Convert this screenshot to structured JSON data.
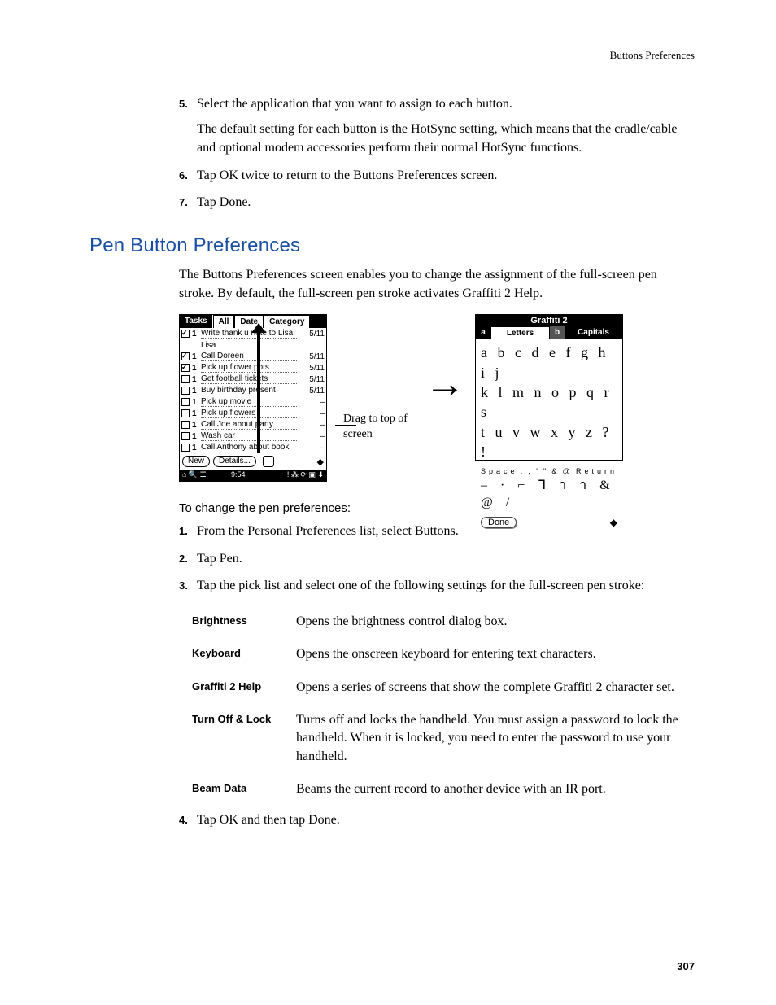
{
  "runningHead": "Buttons Preferences",
  "stepsTop": [
    {
      "n": "5.",
      "text": "Select the application that you want to assign to each button.",
      "sub": "The default setting for each button is the HotSync setting, which means that the cradle/cable and optional modem accessories perform their normal HotSync functions."
    },
    {
      "n": "6.",
      "text": "Tap OK twice to return to the Buttons Preferences screen."
    },
    {
      "n": "7.",
      "text": "Tap Done."
    }
  ],
  "sectionTitle": "Pen Button Preferences",
  "sectionIntro": "The Buttons Preferences screen enables you to change the assignment of the full-screen pen stroke. By default, the full-screen pen stroke activates Graffiti 2 Help.",
  "fig": {
    "tasks": {
      "tabs": [
        "Tasks",
        "All",
        "Date",
        "Category"
      ],
      "rows": [
        {
          "checked": true,
          "pri": "1",
          "text": "Write thank u note to Lisa",
          "date": "5/11",
          "wrap": true
        },
        {
          "checked": true,
          "pri": "1",
          "text": "Call Doreen",
          "date": "5/11"
        },
        {
          "checked": true,
          "pri": "1",
          "text": "Pick up flower pots",
          "date": "5/11"
        },
        {
          "checked": false,
          "pri": "1",
          "text": "Get football tickets",
          "date": "5/11"
        },
        {
          "checked": false,
          "pri": "1",
          "text": "Buy birthday present",
          "date": "5/11"
        },
        {
          "checked": false,
          "pri": "1",
          "text": "Pick up movie",
          "date": "–"
        },
        {
          "checked": false,
          "pri": "1",
          "text": "Pick up flowers",
          "date": "–"
        },
        {
          "checked": false,
          "pri": "1",
          "text": "Call Joe about party",
          "date": "–"
        },
        {
          "checked": false,
          "pri": "1",
          "text": "Wash car",
          "date": "–"
        },
        {
          "checked": false,
          "pri": "1",
          "text": "Call Anthony about book",
          "date": "–"
        }
      ],
      "btnNew": "New",
      "btnDetails": "Details...",
      "time": "9:54"
    },
    "callout": "Drag to top of screen",
    "graffiti": {
      "title": "Graffiti 2",
      "tabLetters": "Letters",
      "tabCapitals": "Capitals",
      "line1": "a b c d e f g h i j",
      "line2": "k l m n o p q r s",
      "line3": "t u v w x y z ? !",
      "labels": [
        "Space",
        ".",
        ",",
        "'",
        "\"",
        "&",
        "@",
        "Return"
      ],
      "syms": "–  · ⌐ ᒣ า า & @  /",
      "done": "Done"
    }
  },
  "subHeading": "To change the pen preferences:",
  "stepsBottom": [
    {
      "n": "1.",
      "text": "From the Personal Preferences list, select Buttons."
    },
    {
      "n": "2.",
      "text": "Tap Pen."
    },
    {
      "n": "3.",
      "text": "Tap the pick list and select one of the following settings for the full-screen pen stroke:"
    }
  ],
  "options": [
    {
      "label": "Brightness",
      "desc": "Opens the brightness control dialog box."
    },
    {
      "label": "Keyboard",
      "desc": "Opens the onscreen keyboard for entering text characters."
    },
    {
      "label": "Graffiti 2 Help",
      "desc": "Opens a series of screens that show the complete Graffiti 2 character set."
    },
    {
      "label": "Turn Off & Lock",
      "desc": "Turns off and locks the handheld. You must assign a password to lock the handheld. When it is locked, you need to enter the password to use your handheld."
    },
    {
      "label": "Beam Data",
      "desc": "Beams the current record to another device with an IR port."
    }
  ],
  "step4": {
    "n": "4.",
    "text": "Tap OK and then tap Done."
  },
  "pageNum": "307"
}
